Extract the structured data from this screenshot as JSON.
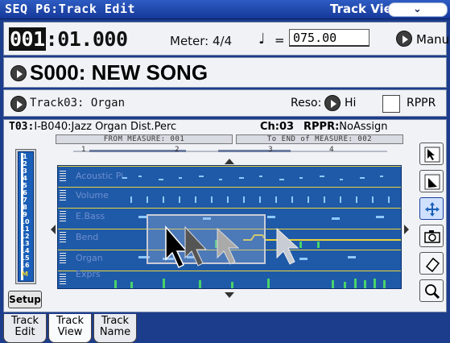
{
  "titlebar": {
    "mode": "SEQ P6:Track Edit",
    "view": "Track View",
    "menu_icon": "chevron-down-icon",
    "menu_glyph": "⌄"
  },
  "locator": {
    "measure": "001",
    "beat_tick": ":01.000",
    "meter_label": "Meter: 4/4",
    "tempo_symbol": "♩",
    "tempo_eq": "=",
    "tempo_value": "075.00",
    "tempo_mode": "Manu"
  },
  "song": {
    "name": "S000: NEW SONG"
  },
  "track_row": {
    "track": "Track03: Organ",
    "reso_label": "Reso:",
    "reso_value": "Hi",
    "rppr_label": "RPPR"
  },
  "track_info": {
    "track_prefix": "T03:",
    "program": "I-B040:Jazz Organ Dist.Perc",
    "ch_label": "Ch:03",
    "rppr_label": "RPPR:",
    "rppr_value": "NoAssign",
    "from_measure": "FROM MEASURE: 001",
    "to_measure": "To END of MEASURE: 002"
  },
  "ruler": {
    "marks": [
      "1",
      "2",
      "3",
      "4"
    ]
  },
  "track_numbers": [
    "1",
    "2",
    "3",
    "4",
    "5",
    "6",
    "7",
    "8",
    "9",
    "10",
    "11",
    "12",
    "13",
    "14",
    "15",
    "16",
    "M"
  ],
  "lanes": [
    {
      "label": "Acoustic Pi"
    },
    {
      "label": "Volume"
    },
    {
      "label": "E.Bass"
    },
    {
      "label": "Bend"
    },
    {
      "label": "Organ"
    },
    {
      "label": "Exprs"
    }
  ],
  "tools": [
    {
      "name": "select-tool-icon"
    },
    {
      "name": "draw-tool-icon"
    },
    {
      "name": "move-tool-icon"
    },
    {
      "name": "camera-tool-icon"
    },
    {
      "name": "eraser-tool-icon"
    },
    {
      "name": "zoom-tool-icon"
    }
  ],
  "setup_label": "Setup",
  "tabs": [
    {
      "line1": "Track",
      "line2": "Edit"
    },
    {
      "line1": "Track",
      "line2": "View"
    },
    {
      "line1": "Track",
      "line2": "Name"
    }
  ],
  "colors": {
    "title_bg": "#16399a",
    "grid_bg": "#1f5aa8",
    "lane_line": "#e9d23c",
    "event_green": "#49d26a"
  }
}
